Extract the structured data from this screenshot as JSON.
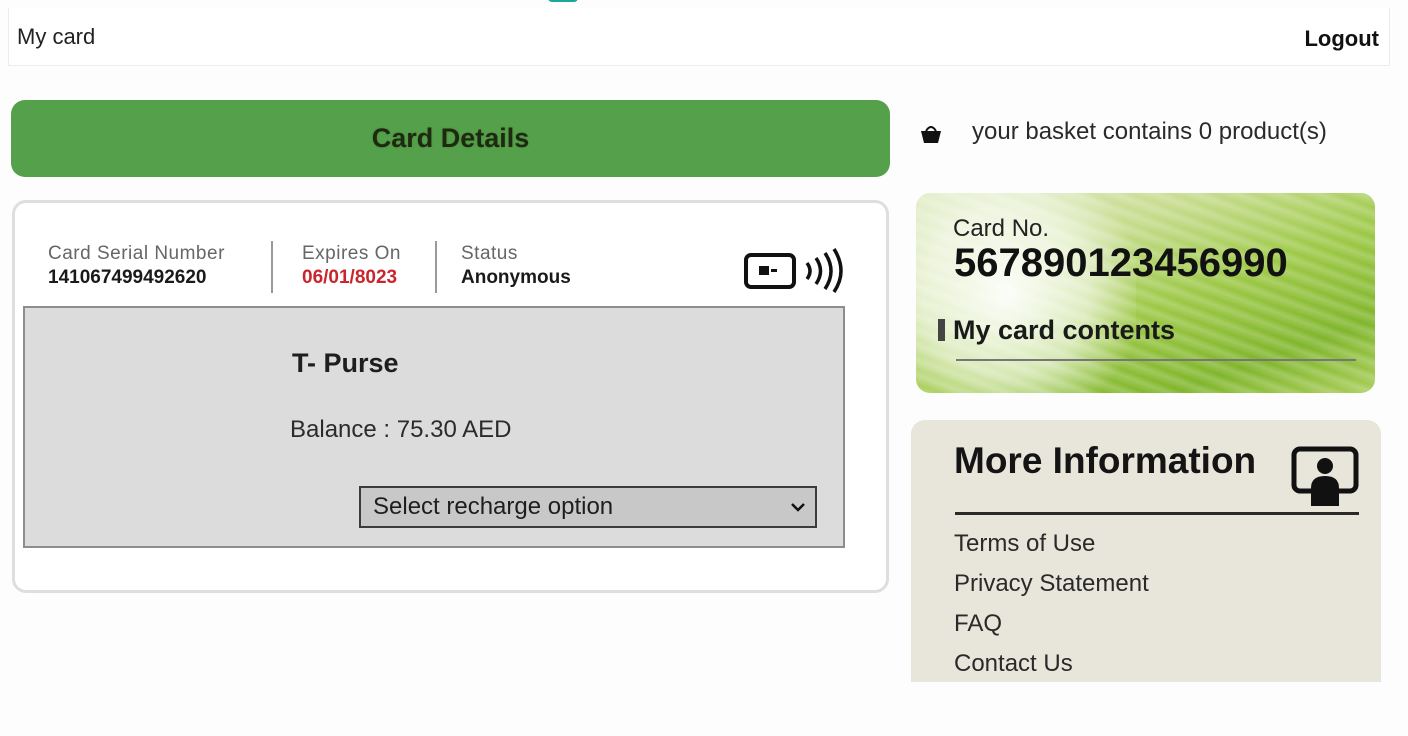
{
  "header": {
    "title": "My card",
    "logout_label": "Logout"
  },
  "card_details": {
    "heading": "Card Details",
    "serial_label": "Card Serial Number",
    "serial_value": "141067499492620",
    "expires_label": "Expires On",
    "expires_value": "06/01/8023",
    "status_label": "Status",
    "status_value": "Anonymous",
    "purse": {
      "title": "T- Purse",
      "balance": "Balance : 75.30 AED",
      "recharge_select": "Select recharge option"
    }
  },
  "basket": {
    "text": "your basket contains  0  product(s)"
  },
  "card_box": {
    "card_no_label": "Card No.",
    "card_no": "567890123456990",
    "contents_link": "My card contents"
  },
  "more_info": {
    "title": "More Information",
    "links": [
      "Terms of Use",
      "Privacy Statement",
      "FAQ",
      "Contact Us"
    ]
  },
  "colors": {
    "header_green": "#55a04a",
    "expires_red": "#c8262c",
    "more_info_bg": "#e8e5da"
  },
  "icons": {
    "nfc": "contactless-card-icon",
    "basket": "basket-icon",
    "info": "person-info-icon",
    "select": "chevron-down-icon"
  }
}
